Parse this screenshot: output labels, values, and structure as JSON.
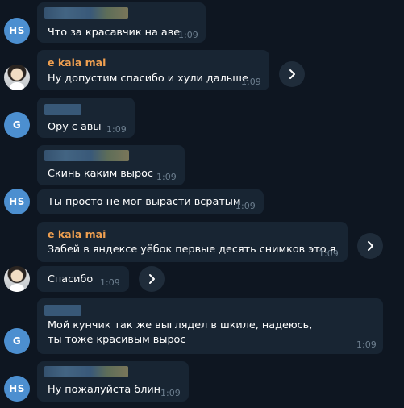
{
  "messages": [
    {
      "time": "1:09",
      "text": "Что за красавчик на аве",
      "avatar": "HS"
    },
    {
      "time": "1:09",
      "sender": "e kala mai",
      "text": "Ну допустим спасибо и хули дальше"
    },
    {
      "time": "1:09",
      "text": "Ору с авы",
      "avatar": "G"
    },
    {
      "time": "1:09",
      "text": "Скинь каким вырос"
    },
    {
      "time": "1:09",
      "text": "Ты просто не мог вырасти всратым",
      "avatar": "HS"
    },
    {
      "time": "1:09",
      "sender": "e kala mai",
      "text": "Забей в яндексе уёбок первые десять снимков это я"
    },
    {
      "time": "1:09",
      "text": "Спасибо"
    },
    {
      "time": "1:09",
      "text": "Мой кунчик так же выглядел в шкиле, надеюсь, ты тоже красивым вырос",
      "avatar": "G"
    },
    {
      "time": "1:09",
      "text": "Ну пожалуйста блин",
      "avatar": "HS"
    }
  ],
  "colors": {
    "background": "#0e1621",
    "bubble": "#182533",
    "sender_name": "#f0a050",
    "avatar_blue": "#4c8fd0"
  },
  "icons": {
    "forward": "chevron-right-icon"
  }
}
